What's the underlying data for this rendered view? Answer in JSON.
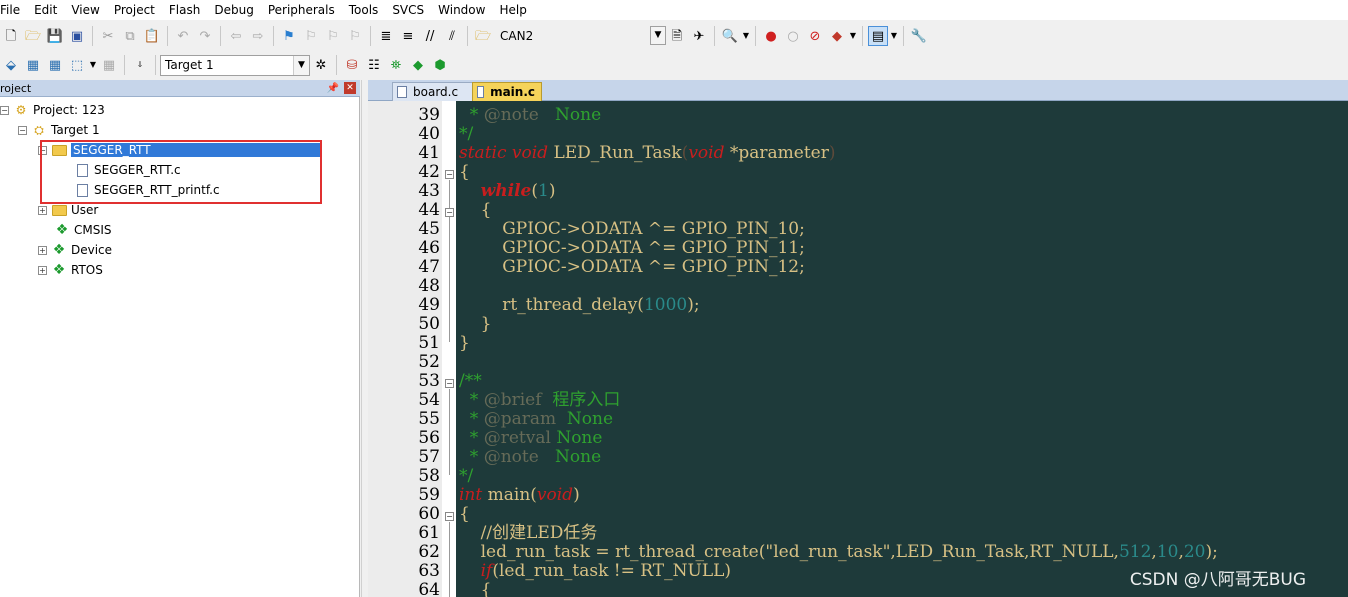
{
  "menu": [
    "File",
    "Edit",
    "View",
    "Project",
    "Flash",
    "Debug",
    "Peripherals",
    "Tools",
    "SVCS",
    "Window",
    "Help"
  ],
  "toolbar": {
    "target_combo": "CAN2",
    "build_target": "Target 1"
  },
  "project_pane": {
    "title": "roject",
    "tree": {
      "project": "Project: 123",
      "target": "Target 1",
      "group_selected": "SEGGER_RTT",
      "files": [
        "SEGGER_RTT.c",
        "SEGGER_RTT_printf.c"
      ],
      "groups": [
        "User",
        "CMSIS",
        "Device",
        "RTOS"
      ]
    }
  },
  "tabs": [
    "board.c",
    "main.c"
  ],
  "editor": {
    "line_numbers": [
      "39",
      "40",
      "41",
      "42",
      "43",
      "44",
      "45",
      "46",
      "47",
      "48",
      "49",
      "50",
      "51",
      "52",
      "53",
      "54",
      "55",
      "56",
      "57",
      "58",
      "59",
      "60",
      "61",
      "62",
      "63",
      "64"
    ],
    "l39": {
      "a": "  * ",
      "b": "@note",
      "c": "   None"
    },
    "l40": "*/",
    "l41": {
      "kw1": "static",
      "kw2": "void",
      "name": " LED_Run_Task",
      "open": "(",
      "kw3": "void",
      "rest": " *parameter",
      "close": ")"
    },
    "l42": "{",
    "l43": {
      "indent": "    ",
      "kw": "while",
      "open": "(",
      "num": "1",
      "close": ")"
    },
    "l44": "    {",
    "l45": "        GPIOC->ODATA ^= GPIO_PIN_10;",
    "l46": "        GPIOC->ODATA ^= GPIO_PIN_11;",
    "l47": "        GPIOC->ODATA ^= GPIO_PIN_12;",
    "l48": "",
    "l49": {
      "a": "        rt_thread_delay(",
      "num": "1000",
      "b": ");"
    },
    "l50": "    }",
    "l51": "}",
    "l52": "",
    "l53": "/**",
    "l54": {
      "a": "  * ",
      "b": "@brief",
      "c": "  程序入口"
    },
    "l55": {
      "a": "  * ",
      "b": "@param",
      "c": "  None"
    },
    "l56": {
      "a": "  * ",
      "b": "@retval",
      "c": " None"
    },
    "l57": {
      "a": "  * ",
      "b": "@note",
      "c": "   None"
    },
    "l58": "*/",
    "l59": {
      "kw": "int",
      "name": " main",
      "open": "(",
      "kw2": "void",
      "close": ")"
    },
    "l60": "{",
    "l61": "    //创建LED任务",
    "l62": {
      "a": "    led_run_task = rt_thread_create(\"led_run_task\",LED_Run_Task,RT_NULL,",
      "n1": "512",
      "c1": ",",
      "n2": "10",
      "c2": ",",
      "n3": "20",
      "b": ");"
    },
    "l63": {
      "indent": "    ",
      "kw": "if",
      "rest": "(led_run_task != RT_NULL)"
    },
    "l64": "    {"
  },
  "watermark": "CSDN @八阿哥无BUG"
}
